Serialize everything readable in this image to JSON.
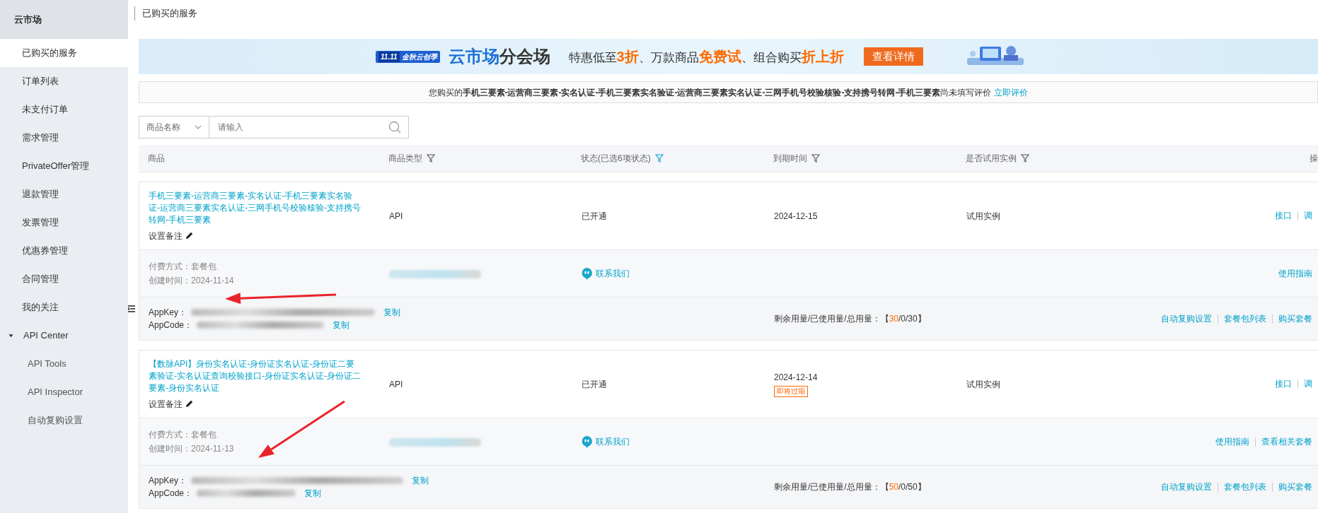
{
  "sidebar": {
    "title": "云市场",
    "items": [
      {
        "kind": "item",
        "label": "已购买的服务",
        "selected": true
      },
      {
        "kind": "item",
        "label": "订单列表",
        "selected": false
      },
      {
        "kind": "item",
        "label": "未支付订单",
        "selected": false
      },
      {
        "kind": "item",
        "label": "需求管理",
        "selected": false
      },
      {
        "kind": "item",
        "label": "PrivateOffer管理",
        "selected": false
      },
      {
        "kind": "item",
        "label": "退款管理",
        "selected": false
      },
      {
        "kind": "item",
        "label": "发票管理",
        "selected": false
      },
      {
        "kind": "item",
        "label": "优惠券管理",
        "selected": false
      },
      {
        "kind": "item",
        "label": "合同管理",
        "selected": false
      },
      {
        "kind": "item",
        "label": "我的关注",
        "selected": false
      },
      {
        "kind": "group",
        "label": "API Center",
        "selected": false,
        "expanded": true,
        "children": [
          {
            "label": "API Tools",
            "selected": false
          },
          {
            "label": "API Inspector",
            "selected": false
          },
          {
            "label": "自动复购设置",
            "selected": false
          }
        ]
      }
    ]
  },
  "page_title": "已购买的服务",
  "banner": {
    "badge": "11.11",
    "badge_text": "金秋云创季",
    "title_a": "云市场",
    "title_b": "分会场",
    "slogan": [
      {
        "text": "特惠低至",
        "highlight": false
      },
      {
        "text": "3折",
        "highlight": true
      },
      {
        "text": "、万款商品",
        "highlight": false
      },
      {
        "text": "免费试",
        "highlight": true
      },
      {
        "text": "、组合购买",
        "highlight": false
      },
      {
        "text": "折上折",
        "highlight": true
      }
    ],
    "button": "查看详情"
  },
  "notice": {
    "text": "您购买的**手机三要素-运营商三要素-实名认证-手机三要素实名验证-运营商三要素实名认证-三网手机号校验核验-支持携号转网-手机三要素**尚未填写评价",
    "link": "立即评价"
  },
  "search": {
    "category": "商品名称",
    "placeholder": "请输入"
  },
  "table": {
    "columns": [
      {
        "label": "商品",
        "filter": false
      },
      {
        "label": "商品类型",
        "filter": true,
        "filter_active": false
      },
      {
        "label": "状态(已选6项状态)",
        "filter": true,
        "filter_active": true
      },
      {
        "label": "到期时间",
        "filter": true,
        "filter_active": false
      },
      {
        "label": "是否试用实例",
        "filter": true,
        "filter_active": false
      },
      {
        "label": "操",
        "filter": false
      }
    ],
    "rows": [
      {
        "name": "手机三要素-运营商三要素-实名认证-手机三要素实名验证-运营商三要素实名认证-三网手机号校验核验-支持携号转网-手机三要素",
        "note": "设置备注",
        "type": "API",
        "status": "已开通",
        "expiry": "2024-12-15",
        "trial": "试用实例",
        "actions": [
          "接口",
          "调"
        ],
        "payment": "付费方式：套餐包",
        "created": "创建时间：2024-11-14",
        "contact": "联系我们",
        "detail_actions": [
          "使用指南"
        ],
        "appkey_label": "AppKey：",
        "appcode_label": "AppCode：",
        "copy_key": "复制",
        "copy_code": "复制",
        "usage_label": "剩余用量/已使用量/总用量：",
        "usage_open": "【",
        "usage_remaining": "30",
        "usage_rest": "/0/30】",
        "bottom_actions": [
          "自动复购设置",
          "套餐包列表",
          "购买套餐"
        ]
      },
      {
        "name": "【数脉API】身份实名认证-身份证实名认证-身份证二要素验证-实名认证查询校验接口-身份证实名认证-身份证二要素-身份实名认证",
        "note": "设置备注",
        "type": "API",
        "status": "已开通",
        "expiry": "2024-12-14",
        "expiry_tag": "即将过期",
        "trial": "试用实例",
        "actions": [
          "接口",
          "调"
        ],
        "payment": "付费方式：套餐包",
        "created": "创建时间：2024-11-13",
        "contact": "联系我们",
        "detail_actions": [
          "使用指南",
          "查看相关套餐"
        ],
        "appkey_label": "AppKey：",
        "appcode_label": "AppCode：",
        "copy_key": "复制",
        "copy_code": "复制",
        "usage_label": "剩余用量/已使用量/总用量：",
        "usage_open": "【",
        "usage_remaining": "50",
        "usage_rest": "/0/50】",
        "bottom_actions": [
          "自动复购设置",
          "套餐包列表",
          "购买套餐"
        ]
      }
    ]
  }
}
